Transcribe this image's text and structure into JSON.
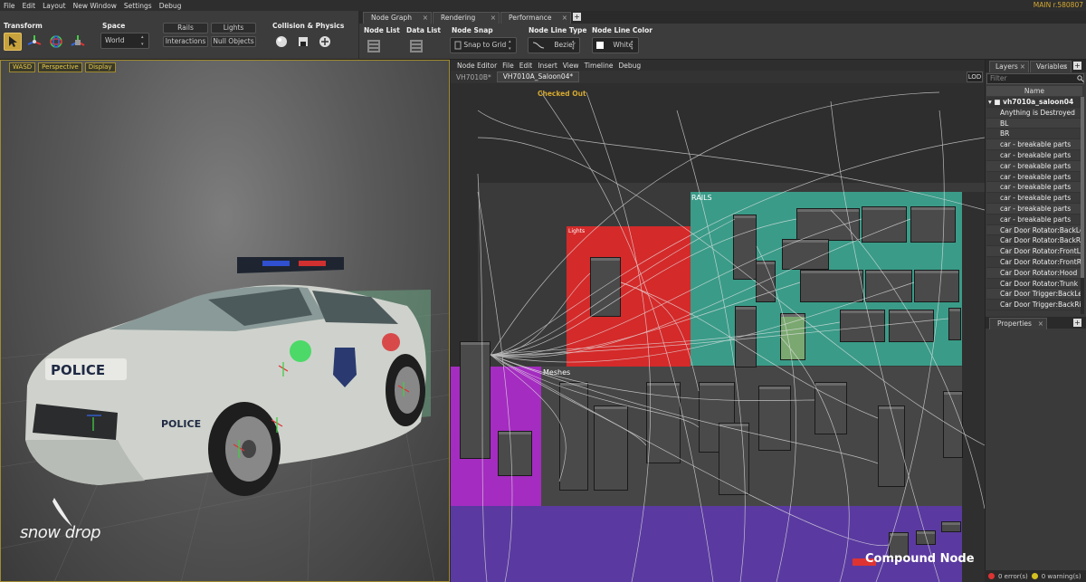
{
  "menubar": {
    "items": [
      "File",
      "Edit",
      "Layout",
      "New Window",
      "Settings",
      "Debug"
    ],
    "status": "MAIN r.580807"
  },
  "toolbar": {
    "transform_label": "Transform",
    "space_label": "Space",
    "space_value": "World",
    "rails_label": "Rails",
    "lights_label": "Lights",
    "interactions_label": "Interactions",
    "null_objects_label": "Null Objects",
    "collision_label": "Collision & Physics"
  },
  "node_graph": {
    "tabs": [
      "Node Graph",
      "Rendering",
      "Performance"
    ],
    "node_list_label": "Node List",
    "data_list_label": "Data List",
    "node_snap_label": "Node Snap",
    "node_snap_value": "Snap to Grid",
    "node_line_type_label": "Node Line Type",
    "node_line_type_value": "Bezier",
    "node_line_color_label": "Node Line Color",
    "node_line_color_value": "White"
  },
  "viewport": {
    "buttons": [
      "WASD",
      "Perspective",
      "Display"
    ],
    "logo": "snow drop"
  },
  "node_editor": {
    "title": "Node Editor",
    "menu": [
      "File",
      "Edit",
      "Insert",
      "View",
      "Timeline",
      "Debug"
    ],
    "breadcrumbs": [
      "VH7010B*",
      "VH7010A_Saloon04*"
    ],
    "lod": "LOD",
    "checked_out": "Checked Out",
    "groups": {
      "rails": "RAILS",
      "lights": "Lights",
      "meshes": "Meshes"
    },
    "compound": "Compound Node"
  },
  "right_panel": {
    "tabs": [
      "Layers",
      "Variables"
    ],
    "filter_placeholder": "Filter",
    "column": "Name",
    "root": "vh7010a_saloon04",
    "layers": [
      "Anything is Destroyed",
      "BL",
      "BR",
      "car - breakable parts",
      "car - breakable parts",
      "car - breakable parts",
      "car - breakable parts",
      "car - breakable parts",
      "car - breakable parts",
      "car - breakable parts",
      "car - breakable parts",
      "Car Door Rotator:BackLeft",
      "Car Door Rotator:BackRight",
      "Car Door Rotator:FrontLeft",
      "Car Door Rotator:FrontRight",
      "Car Door Rotator:Hood",
      "Car Door Rotator:Trunk",
      "Car Door Trigger:BackLeft",
      "Car Door Trigger:BackRight"
    ],
    "properties": "Properties"
  },
  "statusbar": {
    "errors": "0 error(s)",
    "warnings": "0 warning(s)"
  },
  "colors": {
    "accent": "#c8a23c",
    "rails_group": "#3a9b88",
    "lights_group": "#d42a2a",
    "meshes_group": "#a42cc0",
    "purple_group": "#5a3aa0"
  }
}
